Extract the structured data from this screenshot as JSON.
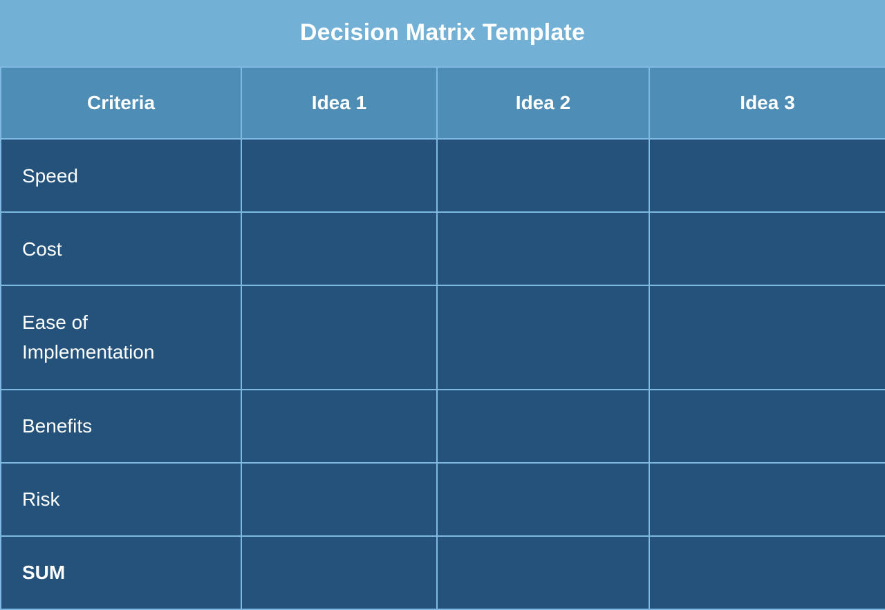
{
  "title": "Decision Matrix Template",
  "colors": {
    "title_band": "#72B0D6",
    "header_row": "#4E8DB6",
    "body_cell": "#24527A",
    "grid_line": "#7FB8E0",
    "text": "#FFFFFF"
  },
  "table": {
    "headers": [
      "Criteria",
      "Idea 1",
      "Idea 2",
      "Idea 3"
    ],
    "rows": [
      {
        "criteria": "Speed",
        "bold": false,
        "scores": [
          "",
          "",
          ""
        ]
      },
      {
        "criteria": "Cost",
        "bold": false,
        "scores": [
          "",
          "",
          ""
        ]
      },
      {
        "criteria": "Ease of Implementation",
        "bold": false,
        "scores": [
          "",
          "",
          ""
        ]
      },
      {
        "criteria": "Benefits",
        "bold": false,
        "scores": [
          "",
          "",
          ""
        ]
      },
      {
        "criteria": "Risk",
        "bold": false,
        "scores": [
          "",
          "",
          ""
        ]
      },
      {
        "criteria": "SUM",
        "bold": true,
        "scores": [
          "",
          "",
          ""
        ]
      }
    ]
  }
}
